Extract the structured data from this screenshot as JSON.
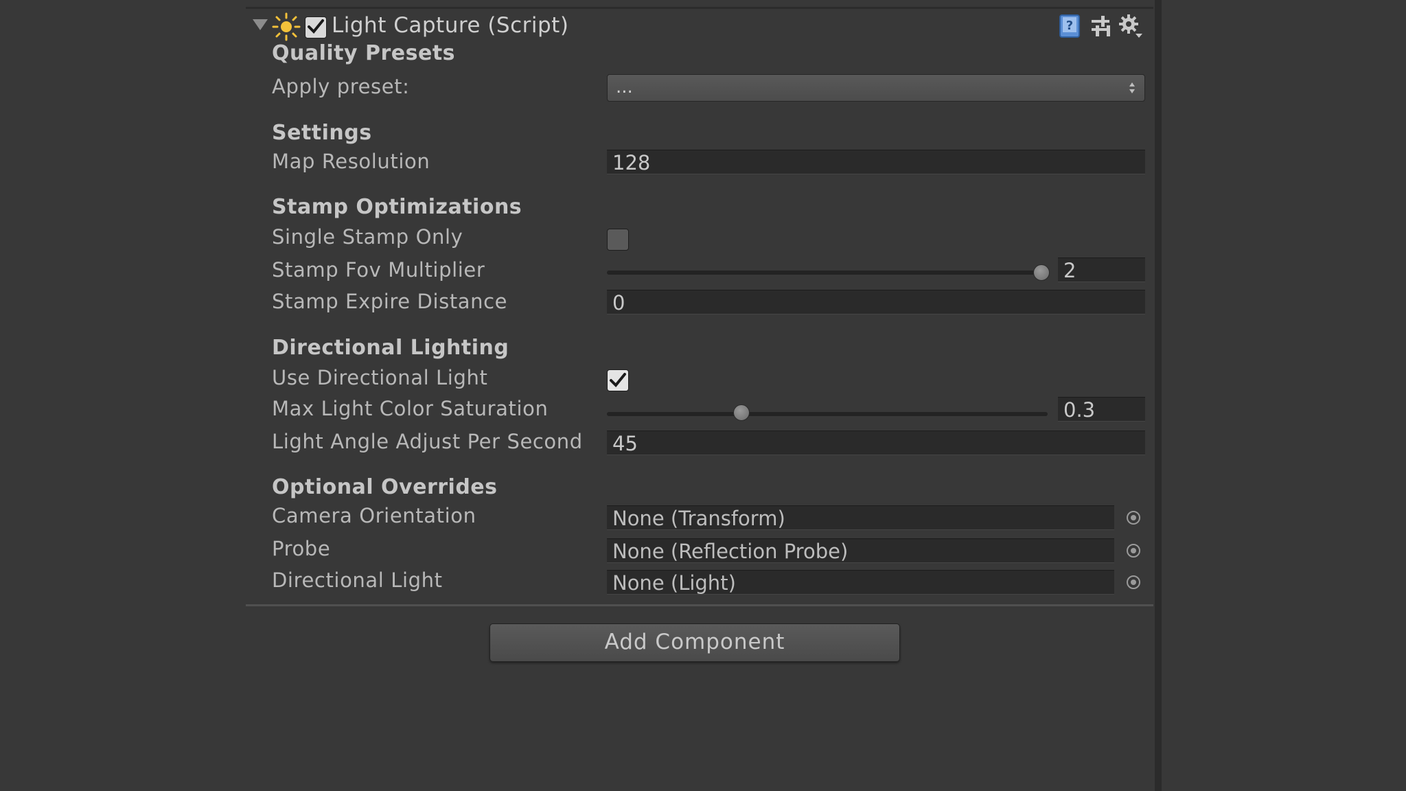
{
  "component": {
    "title": "Light Capture (Script)",
    "enabled": true,
    "icons": [
      "foldout-arrow",
      "sun-icon",
      "help-book-icon",
      "preset-sliders-icon",
      "gear-icon"
    ]
  },
  "sections": {
    "quality_presets": {
      "title": "Quality Presets",
      "apply_preset_label": "Apply preset:",
      "apply_preset_value": "..."
    },
    "settings": {
      "title": "Settings",
      "map_resolution_label": "Map Resolution",
      "map_resolution_value": "128"
    },
    "stamp_optimizations": {
      "title": "Stamp Optimizations",
      "single_stamp_only_label": "Single Stamp Only",
      "single_stamp_only_checked": false,
      "stamp_fov_multiplier_label": "Stamp Fov Multiplier",
      "stamp_fov_multiplier_value": "2",
      "stamp_expire_distance_label": "Stamp Expire Distance",
      "stamp_expire_distance_value": "0"
    },
    "directional_lighting": {
      "title": "Directional Lighting",
      "use_directional_light_label": "Use Directional Light",
      "use_directional_light_checked": true,
      "max_light_color_saturation_label": "Max Light Color Saturation",
      "max_light_color_saturation_value": "0.3",
      "light_angle_adjust_label": "Light Angle Adjust Per Second",
      "light_angle_adjust_value": "45"
    },
    "optional_overrides": {
      "title": "Optional Overrides",
      "camera_orientation_label": "Camera Orientation",
      "camera_orientation_value": "None (Transform)",
      "probe_label": "Probe",
      "probe_value": "None (Reflection Probe)",
      "directional_light_label": "Directional Light",
      "directional_light_value": "None (Light)"
    }
  },
  "add_component_label": "Add Component",
  "colors": {
    "background": "#383838",
    "field_bg": "#2a2a2a",
    "text": "#bdbdbd"
  }
}
